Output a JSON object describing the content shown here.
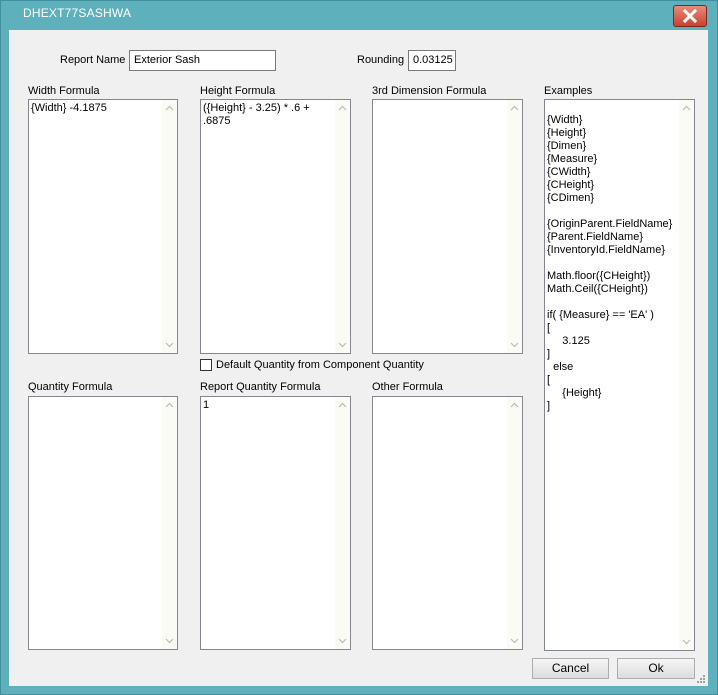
{
  "window": {
    "title": "DHEXT77SASHWA",
    "close_icon": "close-icon"
  },
  "report_name": {
    "label": "Report Name",
    "value": "Exterior Sash"
  },
  "rounding": {
    "label": "Rounding",
    "value": "0.03125"
  },
  "formulas": {
    "width": {
      "label": "Width Formula",
      "value": "{Width} -4.1875"
    },
    "height": {
      "label": "Height Formula",
      "value": "({Height} - 3.25) * .6 +\n.6875"
    },
    "third": {
      "label": "3rd Dimension Formula",
      "value": ""
    },
    "quantity": {
      "label": "Quantity Formula",
      "value": ""
    },
    "report_quantity": {
      "label": "Report Quantity Formula",
      "value": "1"
    },
    "other": {
      "label": "Other Formula",
      "value": ""
    }
  },
  "default_quantity": {
    "label": "Default Quantity from Component Quantity",
    "checked": false
  },
  "examples": {
    "label": "Examples",
    "text": "{Width}\n{Height}\n{Dimen}\n{Measure}\n{CWidth}\n{CHeight}\n{CDimen}\n\n{OriginParent.FieldName}\n{Parent.FieldName}\n{InventoryId.FieldName}\n\nMath.floor({CHeight})\nMath.Ceil({CHeight})\n\nif( {Measure} == 'EA' )\n[\n     3.125\n]\n  else\n[\n     {Height}\n]"
  },
  "buttons": {
    "cancel": "Cancel",
    "ok": "Ok"
  },
  "colors": {
    "titlebar": "#5fb0bd",
    "client": "#f0f0f0",
    "close": "#c9432e"
  }
}
